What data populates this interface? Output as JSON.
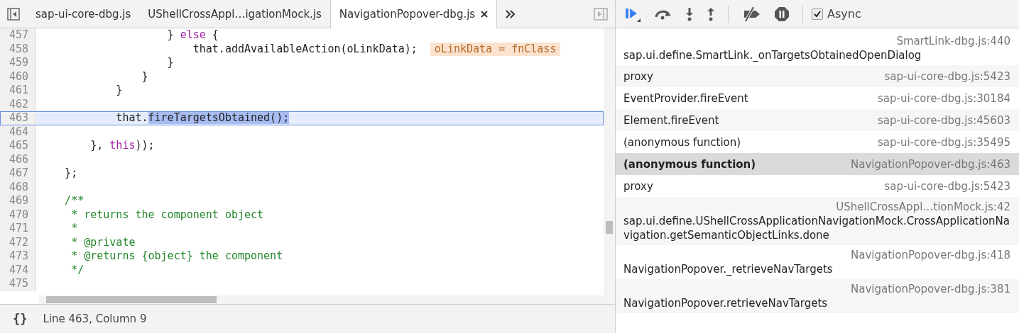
{
  "editor": {
    "tabs": [
      {
        "label": "sap-ui-core-dbg.js",
        "selected": false
      },
      {
        "label": "UShellCrossAppl…igationMock.js",
        "selected": false
      },
      {
        "label": "NavigationPopover-dbg.js",
        "selected": true,
        "closable": true
      }
    ],
    "lines": [
      {
        "number": "457",
        "tokens": [
          {
            "kind": "plain",
            "text": "                    } "
          },
          {
            "kind": "keyword",
            "text": "else"
          },
          {
            "kind": "plain",
            "text": " {"
          }
        ]
      },
      {
        "number": "458",
        "tokens": [
          {
            "kind": "plain",
            "text": "                        that.addAvailableAction(oLinkData);"
          }
        ],
        "inline_value": "oLinkData = fnClass"
      },
      {
        "number": "459",
        "tokens": [
          {
            "kind": "plain",
            "text": "                    }"
          }
        ]
      },
      {
        "number": "460",
        "tokens": [
          {
            "kind": "plain",
            "text": "                }"
          }
        ]
      },
      {
        "number": "461",
        "tokens": [
          {
            "kind": "plain",
            "text": "            }"
          }
        ]
      },
      {
        "number": "462"
      },
      {
        "number": "463",
        "current": true,
        "tokens": [
          {
            "kind": "plain",
            "text": "            that."
          },
          {
            "kind": "selection",
            "text": "fireTargetsObtained();"
          }
        ]
      },
      {
        "number": "464"
      },
      {
        "number": "465",
        "tokens": [
          {
            "kind": "plain",
            "text": "        }, "
          },
          {
            "kind": "keyword",
            "text": "this"
          },
          {
            "kind": "plain",
            "text": "));"
          }
        ]
      },
      {
        "number": "466"
      },
      {
        "number": "467",
        "tokens": [
          {
            "kind": "plain",
            "text": "    };"
          }
        ]
      },
      {
        "number": "468"
      },
      {
        "number": "469",
        "tokens": [
          {
            "kind": "comment",
            "text": "    /**"
          }
        ]
      },
      {
        "number": "470",
        "tokens": [
          {
            "kind": "comment",
            "text": "     * returns the component object"
          }
        ]
      },
      {
        "number": "471",
        "tokens": [
          {
            "kind": "comment",
            "text": "     *"
          }
        ]
      },
      {
        "number": "472",
        "tokens": [
          {
            "kind": "comment",
            "text": "     * @private"
          }
        ]
      },
      {
        "number": "473",
        "tokens": [
          {
            "kind": "comment",
            "text": "     * @returns {object} the component"
          }
        ]
      },
      {
        "number": "474",
        "tokens": [
          {
            "kind": "comment",
            "text": "     */"
          }
        ]
      },
      {
        "number": "475"
      }
    ],
    "status_bar": {
      "format_button": "{}",
      "position": "Line 463, Column 9"
    }
  },
  "debugger": {
    "toolbar": {
      "async": {
        "label": "Async",
        "checked": true
      }
    },
    "call_stack": [
      {
        "kind": "stacked",
        "name": "sap.ui.define.SmartLink._onTargetsObtainedOpenDialog",
        "location": "SmartLink-dbg.js:440",
        "selected": false
      },
      {
        "kind": "inline",
        "name": "proxy",
        "location": "sap-ui-core-dbg.js:5423",
        "selected": false
      },
      {
        "kind": "inline",
        "name": "EventProvider.fireEvent",
        "location": "sap-ui-core-dbg.js:30184",
        "selected": false
      },
      {
        "kind": "inline",
        "name": "Element.fireEvent",
        "location": "sap-ui-core-dbg.js:45603",
        "selected": false
      },
      {
        "kind": "inline",
        "name": "(anonymous function)",
        "location": "sap-ui-core-dbg.js:35495",
        "selected": false
      },
      {
        "kind": "inline",
        "name": "(anonymous function)",
        "location": "NavigationPopover-dbg.js:463",
        "selected": true
      },
      {
        "kind": "inline",
        "name": "proxy",
        "location": "sap-ui-core-dbg.js:5423",
        "selected": false
      },
      {
        "kind": "stacked",
        "name": "sap.ui.define.UShellCrossApplicationNavigationMock.CrossApplicationNavigation.getSemanticObjectLinks.done",
        "location": "UShellCrossAppl…tionMock.js:42",
        "selected": false
      },
      {
        "kind": "stacked",
        "name": "NavigationPopover._retrieveNavTargets",
        "location": "NavigationPopover-dbg.js:418",
        "selected": false
      },
      {
        "kind": "stacked",
        "name": "NavigationPopover.retrieveNavTargets",
        "location": "NavigationPopover-dbg.js:381",
        "selected": false
      }
    ]
  }
}
